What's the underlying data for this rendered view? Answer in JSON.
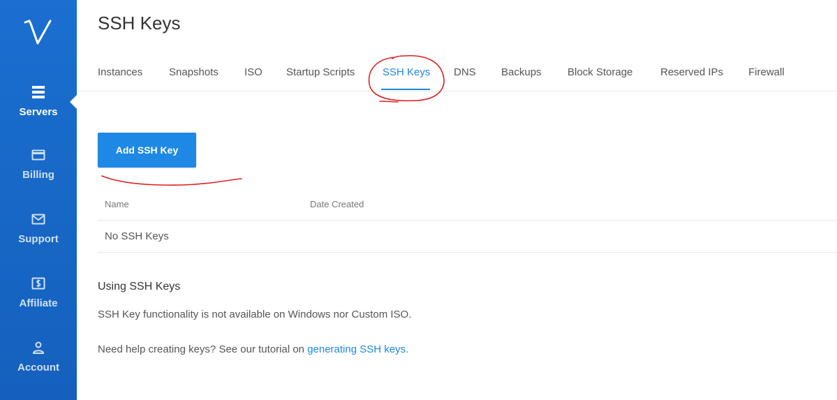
{
  "sidebar": {
    "items": [
      {
        "label": "Servers",
        "icon": "servers-icon",
        "active": true
      },
      {
        "label": "Billing",
        "icon": "credit-card-icon",
        "active": false
      },
      {
        "label": "Support",
        "icon": "envelope-icon",
        "active": false
      },
      {
        "label": "Affiliate",
        "icon": "dollar-icon",
        "active": false
      },
      {
        "label": "Account",
        "icon": "user-icon",
        "active": false
      }
    ]
  },
  "header": {
    "title": "SSH Keys"
  },
  "tabs": [
    {
      "label": "Instances"
    },
    {
      "label": "Snapshots"
    },
    {
      "label": "ISO"
    },
    {
      "label": "Startup Scripts"
    },
    {
      "label": "SSH Keys",
      "active": true
    },
    {
      "label": "DNS"
    },
    {
      "label": "Backups"
    },
    {
      "label": "Block Storage"
    },
    {
      "label": "Reserved IPs"
    },
    {
      "label": "Firewall"
    }
  ],
  "main": {
    "add_button_label": "Add SSH Key",
    "table": {
      "columns": [
        "Name",
        "Date Created"
      ],
      "empty_message": "No SSH Keys"
    },
    "info": {
      "title": "Using SSH Keys",
      "line1": "SSH Key functionality is not available on Windows nor Custom ISO.",
      "line2_prefix": "Need help creating keys? See our tutorial on ",
      "line2_link": "generating SSH keys."
    }
  },
  "colors": {
    "sidebar": "#1a6fd0",
    "accent": "#1e88e5",
    "annotation": "#e02020"
  }
}
